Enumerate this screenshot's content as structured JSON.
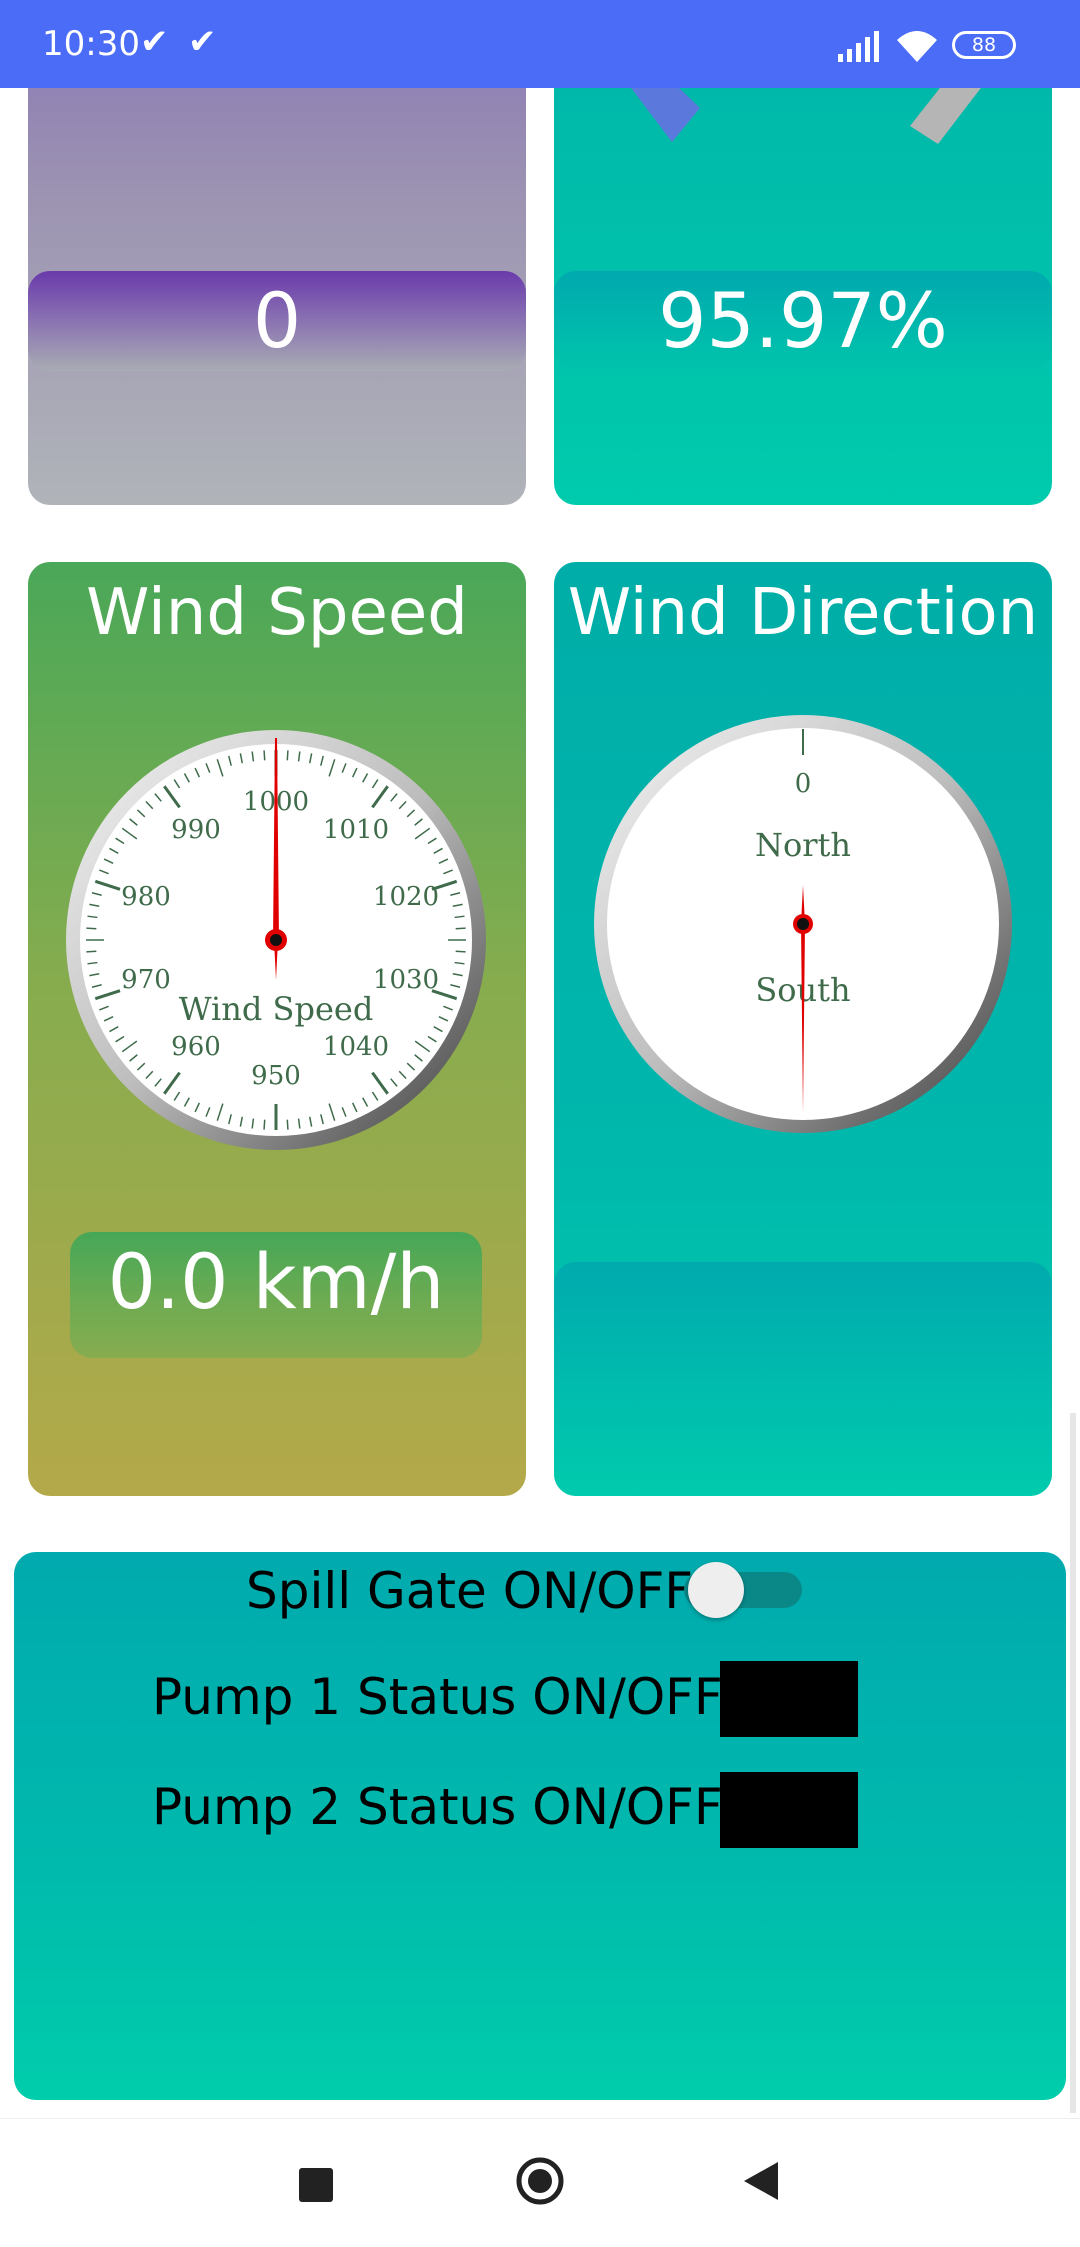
{
  "status_bar": {
    "time": "10:30",
    "check_icons": [
      "✔",
      "✔"
    ],
    "battery": "88",
    "bg_color": "#4a6cf7"
  },
  "cards": {
    "top_left": {
      "value": "0"
    },
    "top_right": {
      "value": "95.97%"
    },
    "wind_speed": {
      "title": "Wind Speed",
      "gauge_label": "Wind Speed",
      "ticks": [
        "950",
        "960",
        "970",
        "980",
        "990",
        "1000",
        "1010",
        "1020",
        "1030",
        "1040"
      ],
      "needle_value": 1000,
      "value": "0.0 km/h"
    },
    "wind_direction": {
      "title": "Wind Direction",
      "gauge_zero": "0",
      "north_label": "North",
      "south_label": "South"
    }
  },
  "controls": {
    "spill_gate_label": "Spill Gate ON/OFF",
    "spill_gate_on": false,
    "pump1_label": "Pump 1 Status ON/OFF:",
    "pump2_label": "Pump 2 Status ON/OFF:"
  },
  "navbar": {
    "icons": [
      "square-icon",
      "home-circle-icon",
      "back-triangle-icon"
    ]
  }
}
